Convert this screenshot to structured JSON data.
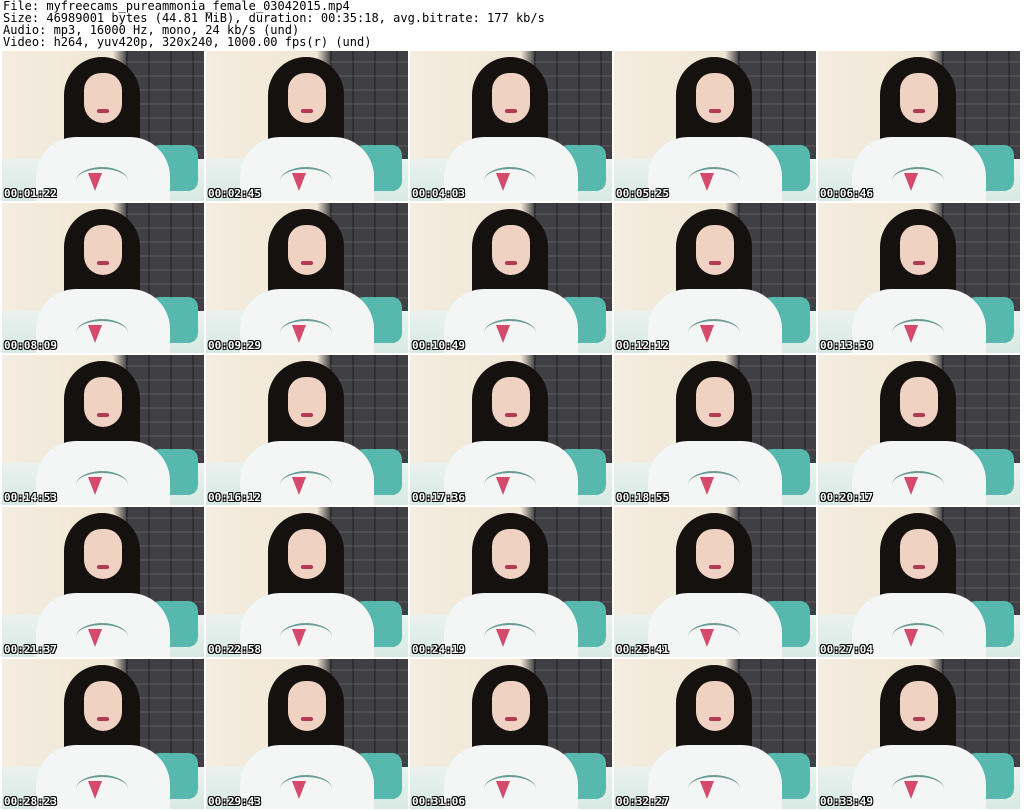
{
  "header": {
    "file": "File: myfreecams_pureammonia_female_03042015.mp4",
    "size": "Size: 46989001 bytes (44.81 MiB), duration: 00:35:18, avg.bitrate: 177 kb/s",
    "audio": "Audio: mp3, 16000 Hz, mono, 24 kb/s (und)",
    "video": "Video: h264, yuv420p, 320x240, 1000.00 fps(r) (und)"
  },
  "thumbnails": [
    {
      "timestamp": "00:01:22"
    },
    {
      "timestamp": "00:02:45"
    },
    {
      "timestamp": "00:04:03"
    },
    {
      "timestamp": "00:05:25"
    },
    {
      "timestamp": "00:06:46"
    },
    {
      "timestamp": "00:08:09"
    },
    {
      "timestamp": "00:09:29"
    },
    {
      "timestamp": "00:10:49"
    },
    {
      "timestamp": "00:12:12"
    },
    {
      "timestamp": "00:13:30"
    },
    {
      "timestamp": "00:14:53"
    },
    {
      "timestamp": "00:16:12"
    },
    {
      "timestamp": "00:17:36"
    },
    {
      "timestamp": "00:18:55"
    },
    {
      "timestamp": "00:20:17"
    },
    {
      "timestamp": "00:21:37"
    },
    {
      "timestamp": "00:22:58"
    },
    {
      "timestamp": "00:24:19"
    },
    {
      "timestamp": "00:25:41"
    },
    {
      "timestamp": "00:27:04"
    },
    {
      "timestamp": "00:28:23"
    },
    {
      "timestamp": "00:29:43"
    },
    {
      "timestamp": "00:31:06"
    },
    {
      "timestamp": "00:32:27"
    },
    {
      "timestamp": "00:33:49"
    }
  ]
}
